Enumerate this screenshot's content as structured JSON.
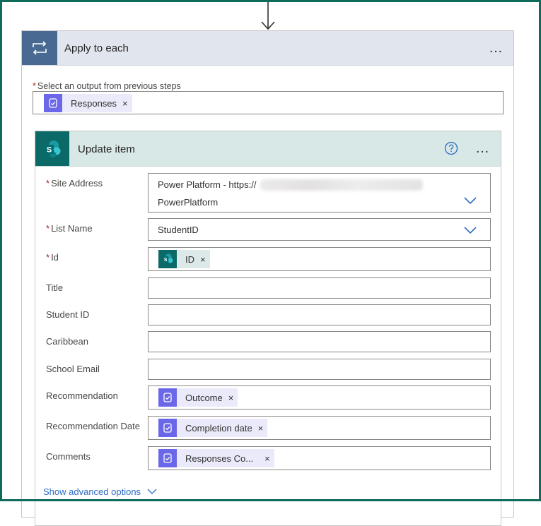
{
  "apply_each": {
    "title": "Apply to each",
    "more_label": "…",
    "select_output_label": "Select an output from previous steps",
    "required_mark": "*",
    "token": {
      "label": "Responses",
      "close": "×",
      "icon": "forms-icon"
    }
  },
  "update_item": {
    "title": "Update item",
    "help_icon": "help-circle-icon",
    "more_label": "…",
    "fields": {
      "site_address": {
        "label": "Site Address",
        "line1": "Power Platform - https://",
        "line2": "PowerPlatform"
      },
      "list_name": {
        "label": "List Name",
        "value": "StudentID"
      },
      "id": {
        "label": "Id",
        "token": "ID"
      },
      "title": {
        "label": "Title",
        "value": ""
      },
      "student_id": {
        "label": "Student ID",
        "value": ""
      },
      "caribbean": {
        "label": "Caribbean",
        "value": ""
      },
      "school_email": {
        "label": "School Email",
        "value": ""
      },
      "recommendation": {
        "label": "Recommendation",
        "token": "Outcome"
      },
      "recommendation_date": {
        "label": "Recommendation Date",
        "token": "Completion date"
      },
      "comments": {
        "label": "Comments",
        "token": "Responses Co..."
      }
    },
    "token_close": "×",
    "show_advanced": "Show advanced options"
  },
  "colors": {
    "loop_header": "#e1e5ee",
    "loop_badge": "#486991",
    "sp_header": "#d7e8e6",
    "sp_badge": "#0b6a67",
    "token_bg": "#ebeafa",
    "forms_icon_bg": "#6a67e8",
    "link": "#2b6cc4",
    "required": "#a4262c",
    "frame": "#0f6b5a"
  }
}
